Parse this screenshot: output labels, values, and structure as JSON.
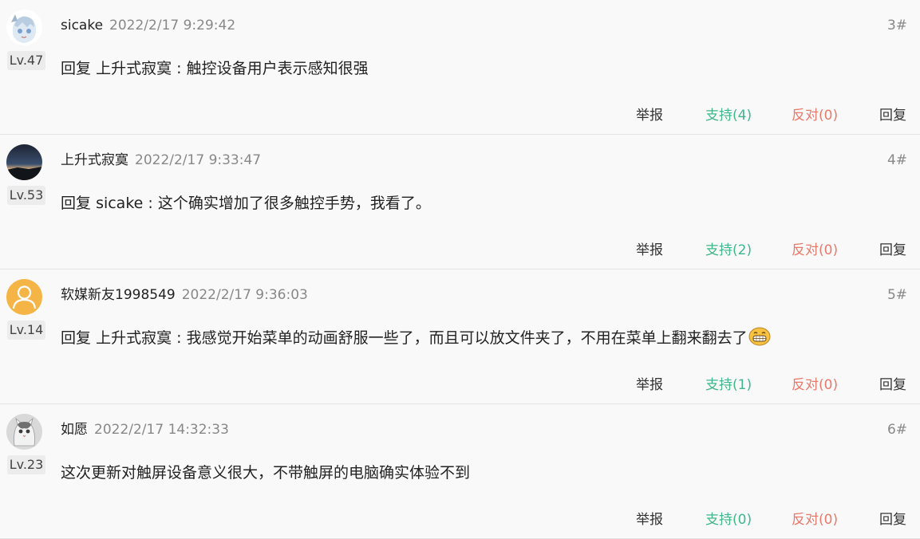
{
  "comments": [
    {
      "username": "sicake",
      "timestamp": "2022/2/17 9:29:42",
      "floor": "3#",
      "level": "Lv.47",
      "avatar_icon": "anime-girl-avatar-icon",
      "reply_prefix": "回复",
      "reply_target": "上升式寂寞",
      "separator": " : ",
      "text": "触控设备用户表示感知很强",
      "actions": {
        "report": "举报",
        "support": "支持(4)",
        "oppose": "反对(0)",
        "reply": "回复"
      }
    },
    {
      "username": "上升式寂寞",
      "timestamp": "2022/2/17 9:33:47",
      "floor": "4#",
      "level": "Lv.53",
      "avatar_icon": "sunset-landscape-avatar-icon",
      "reply_prefix": "回复",
      "reply_target": "sicake",
      "separator": " : ",
      "text": "这个确实增加了很多触控手势，我看了。",
      "actions": {
        "report": "举报",
        "support": "支持(2)",
        "oppose": "反对(0)",
        "reply": "回复"
      }
    },
    {
      "username": "软媒新友1998549",
      "timestamp": "2022/2/17 9:36:03",
      "floor": "5#",
      "level": "Lv.14",
      "avatar_icon": "default-user-avatar-icon",
      "reply_prefix": "回复",
      "reply_target": "上升式寂寞",
      "separator": " : ",
      "text": "我感觉开始菜单的动画舒服一些了，而且可以放文件夹了，不用在菜单上翻来翻去了",
      "emoji_icon": "grinning-emoji-icon",
      "actions": {
        "report": "举报",
        "support": "支持(1)",
        "oppose": "反对(0)",
        "reply": "回复"
      }
    },
    {
      "username": "如愿",
      "timestamp": "2022/2/17 14:32:33",
      "floor": "6#",
      "level": "Lv.23",
      "avatar_icon": "cat-avatar-icon",
      "text": "这次更新对触屏设备意义很大，不带触屏的电脑确实体验不到",
      "actions": {
        "report": "举报",
        "support": "支持(0)",
        "oppose": "反对(0)",
        "reply": "回复"
      }
    }
  ],
  "colors": {
    "support": "#3fb68b",
    "oppose": "#e87a6b",
    "muted": "#888888",
    "background": "#f9f9f9"
  }
}
